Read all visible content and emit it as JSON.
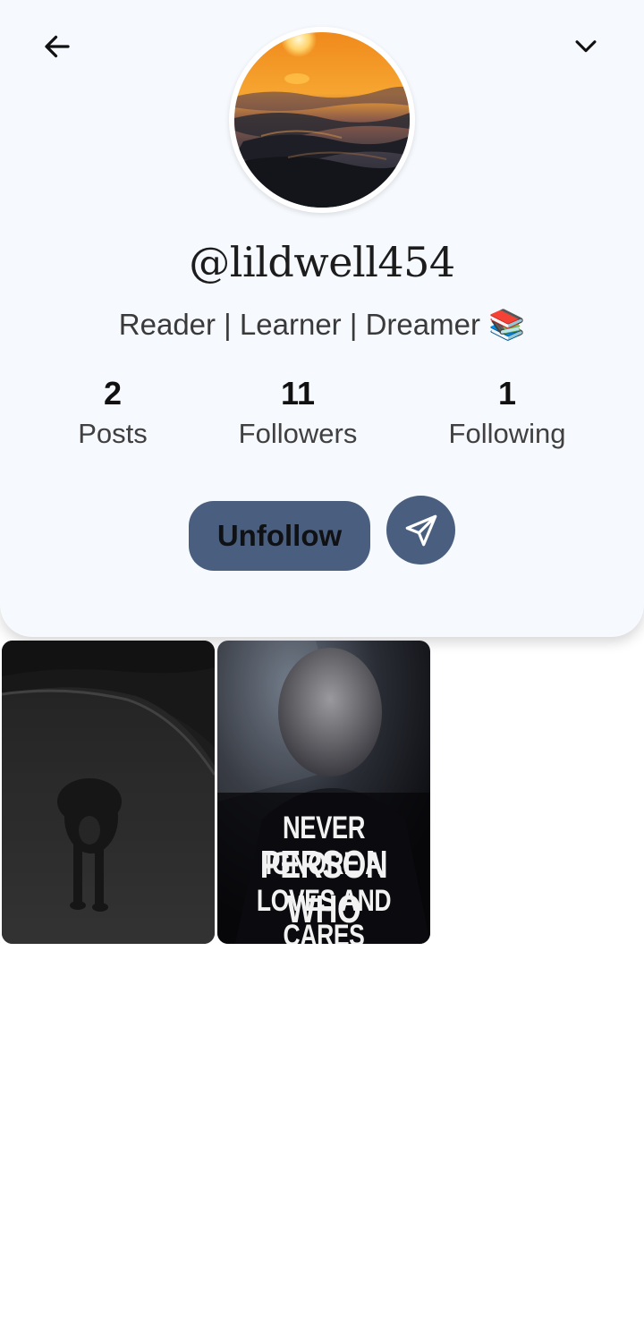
{
  "header": {
    "back_icon": "arrow-left-icon",
    "menu_icon": "chevron-down-icon"
  },
  "profile": {
    "avatar_icon": "sunset-ocean-avatar",
    "username": "@lildwell454",
    "bio": "Reader | Learner | Dreamer 📚",
    "stats": {
      "posts": {
        "count": "2",
        "label": "Posts"
      },
      "followers": {
        "count": "11",
        "label": "Followers"
      },
      "following": {
        "count": "1",
        "label": "Following"
      }
    },
    "actions": {
      "unfollow_label": "Unfollow",
      "message_icon": "send-icon"
    }
  },
  "posts": [
    {
      "thumbnail": "lion-walking-road"
    },
    {
      "thumbnail": "man-quote",
      "caption_lines": [
        "NEVER IGNORE A",
        "PERSON WHO",
        "LOVES AND CARES"
      ]
    }
  ],
  "colors": {
    "card_background": "#f6f9fd",
    "button_background": "#4a5f7f",
    "page_background": "#ffffff"
  }
}
